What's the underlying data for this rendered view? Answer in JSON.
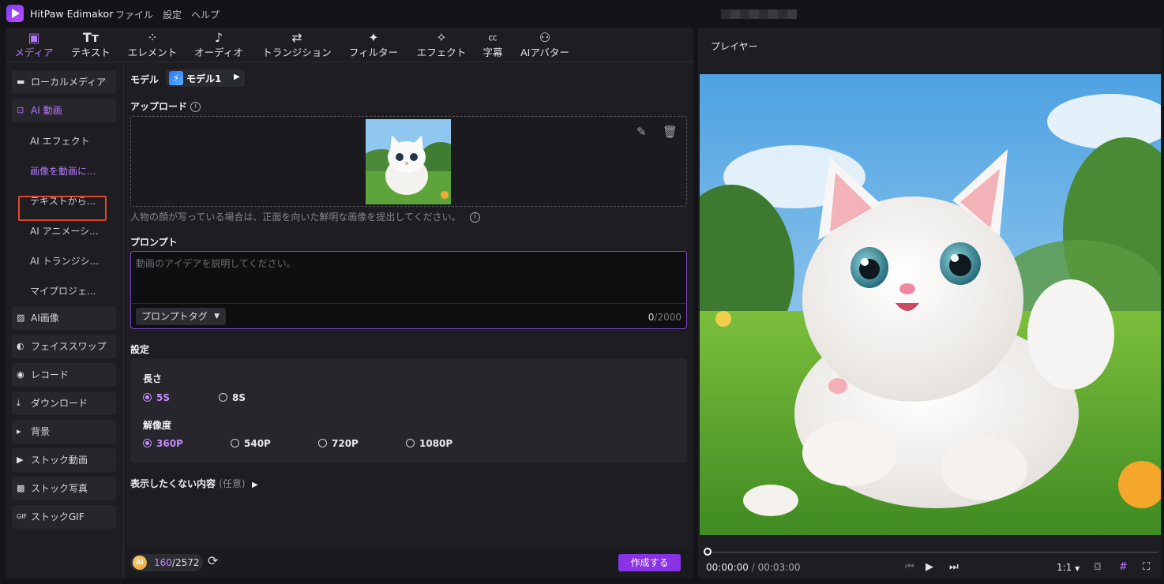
{
  "app": {
    "name": "HitPaw Edimakor",
    "menus": [
      "ファイル",
      "設定",
      "ヘルプ"
    ]
  },
  "toptabs": [
    {
      "label": "メディア",
      "icon": "media-icon",
      "glyph": "🖼",
      "active": true
    },
    {
      "label": "テキスト",
      "icon": "text-icon",
      "glyph": "T"
    },
    {
      "label": "エレメント",
      "icon": "element-icon",
      "glyph": "⁘"
    },
    {
      "label": "オーディオ",
      "icon": "audio-icon",
      "glyph": "♪"
    },
    {
      "label": "トランジション",
      "icon": "transition-icon",
      "glyph": "⇄"
    },
    {
      "label": "フィルター",
      "icon": "filter-icon",
      "glyph": "✦"
    },
    {
      "label": "エフェクト",
      "icon": "effect-icon",
      "glyph": "✧"
    },
    {
      "label": "字幕",
      "icon": "subtitle-icon",
      "glyph": "CC"
    },
    {
      "label": "AIアバター",
      "icon": "avatar-icon",
      "glyph": "👤"
    }
  ],
  "sidebar": {
    "local_media": "ローカルメディア",
    "ai_video": "AI 動画",
    "ai_video_sub": [
      "AI エフェクト",
      "画像を動画に...",
      "テキストから...",
      "AI アニメーシ...",
      "AI トランジシ...",
      "マイプロジェ..."
    ],
    "items": [
      "AI画像",
      "フェイススワップ",
      "レコード",
      "ダウンロード",
      "背景",
      "ストック動画",
      "ストック写真",
      "ストックGIF"
    ]
  },
  "content": {
    "model_label": "モデル",
    "model_name": "モデル1",
    "upload_label": "アップロード",
    "upload_hint": "人物の顔が写っている場合は、正面を向いた鮮明な画像を提出してください。",
    "prompt_label": "プロンプト",
    "prompt_placeholder": "動画のアイデアを説明してください。",
    "prompt_tag": "プロンプトタグ",
    "prompt_count": "0",
    "prompt_max": "/2000",
    "settings_label": "設定",
    "length_label": "長さ",
    "length_options": [
      "5S",
      "8S"
    ],
    "length_selected": "5S",
    "resolution_label": "解像度",
    "resolution_options": [
      "360P",
      "540P",
      "720P",
      "1080P"
    ],
    "resolution_selected": "360P",
    "negative_label": "表示したくない内容",
    "negative_optional": "(任意)"
  },
  "footer": {
    "credits_used": "160",
    "credits_total": "/2572",
    "create_label": "作成する"
  },
  "player": {
    "title": "プレイヤー",
    "time_current": "00:00:00",
    "time_sep": " / ",
    "time_total": "00:03:00",
    "ratio": "1:1"
  },
  "colors": {
    "accent": "#b678ff",
    "button": "#8a32e6",
    "highlight_box": "#e2442d"
  }
}
